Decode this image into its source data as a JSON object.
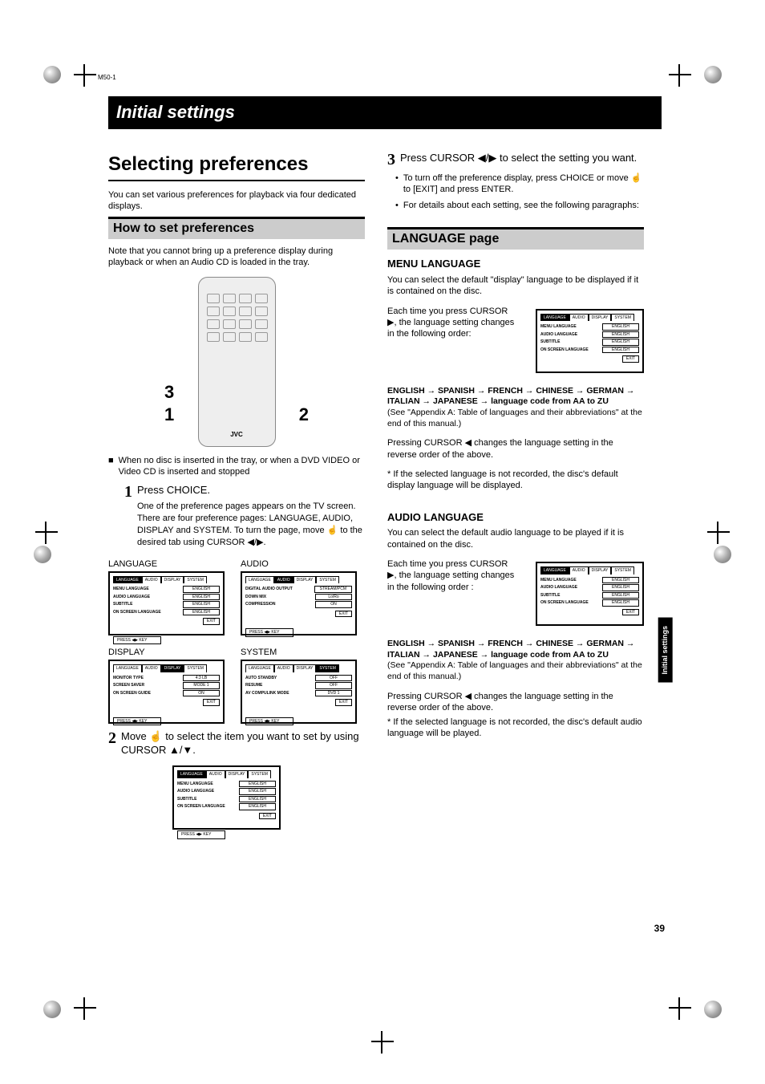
{
  "header_code": "M50-1",
  "banner_title": "Initial settings",
  "main_heading": "Selecting preferences",
  "intro": "You can set various preferences for playback via four dedicated displays.",
  "howto_title": "How to set preferences",
  "howto_note": "Note that you cannot bring up a preference display during playback or when an Audio CD is loaded in the tray.",
  "remote_callouts": {
    "c1": "3",
    "c2": "1",
    "c3": "2"
  },
  "nodisk_note": "When no disc is inserted in the tray, or when a DVD VIDEO or Video CD is inserted and stopped",
  "steps": {
    "s1": {
      "num": "1",
      "title": "Press CHOICE.",
      "body": "One of the preference pages appears on the TV screen. There are four preference pages: LANGUAGE, AUDIO, DISPLAY and SYSTEM. To turn the page, move ☝ to the desired tab using CURSOR ◀/▶."
    },
    "s2": {
      "num": "2",
      "title": "Move ☝ to select the item you want to set by using CURSOR ▲/▼."
    },
    "s3": {
      "num": "3",
      "title": "Press CURSOR ◀/▶ to select the setting you want.",
      "b1": "To turn off the preference display, press CHOICE or move ☝ to [EXIT] and press ENTER.",
      "b2": "For details about each setting, see the following paragraphs:"
    }
  },
  "osd_labels": {
    "language": "LANGUAGE",
    "audio": "AUDIO",
    "display": "DISPLAY",
    "system": "SYSTEM",
    "press_key": "PRESS ◀▶ KEY",
    "exit": "EXIT"
  },
  "language_page": {
    "rows": [
      {
        "label": "MENU LANGUAGE",
        "value": "ENGLISH"
      },
      {
        "label": "AUDIO LANGUAGE",
        "value": "ENGLISH"
      },
      {
        "label": "SUBTITLE",
        "value": "ENGLISH"
      },
      {
        "label": "ON SCREEN LANGUAGE",
        "value": "ENGLISH"
      }
    ]
  },
  "audio_page": {
    "rows": [
      {
        "label": "DIGITAL AUDIO OUTPUT",
        "value": "STREAM/PCM"
      },
      {
        "label": "DOWN MIX",
        "value": "Lo/Ro"
      },
      {
        "label": "COMPRESSION",
        "value": "ON"
      }
    ]
  },
  "display_page": {
    "rows": [
      {
        "label": "MONITOR TYPE",
        "value": "4:3 LB"
      },
      {
        "label": "SCREEN SAVER",
        "value": "MODE 1"
      },
      {
        "label": "ON SCREEN GUIDE",
        "value": "ON"
      }
    ]
  },
  "system_page": {
    "rows": [
      {
        "label": "AUTO STANDBY",
        "value": "OFF"
      },
      {
        "label": "RESUME",
        "value": "OFF"
      },
      {
        "label": "AV COMPULINK MODE",
        "value": "DVD 1"
      }
    ]
  },
  "lang_section": {
    "title": "LANGUAGE page",
    "menu_h": "MENU LANGUAGE",
    "menu_body": "You can select the default \"display\" language to be displayed if it is contained on the disc.",
    "menu_each": "Each time you press CURSOR ▶, the language setting changes in the following order:",
    "cycle_bold": "ENGLISH → SPANISH → FRENCH → CHINESE → GERMAN → ITALIAN → JAPANESE → language code from AA to ZU",
    "appendix": "(See \"Appendix A: Table of languages and their abbreviations\" at the end of this manual.)",
    "reverse": "Pressing CURSOR ◀ changes the language setting in the reverse order of the above.",
    "star_display": "* If the selected language is not recorded, the disc's default display language will be displayed.",
    "audio_h": "AUDIO LANGUAGE",
    "audio_body": "You can select the default audio language to be played if it is contained on the disc.",
    "audio_each": "Each time you press CURSOR ▶, the language setting changes in the following order :",
    "star_audio": "* If the selected language is not recorded, the disc's default audio language will be played."
  },
  "side_tab": "Initial settings",
  "page_number": "39"
}
